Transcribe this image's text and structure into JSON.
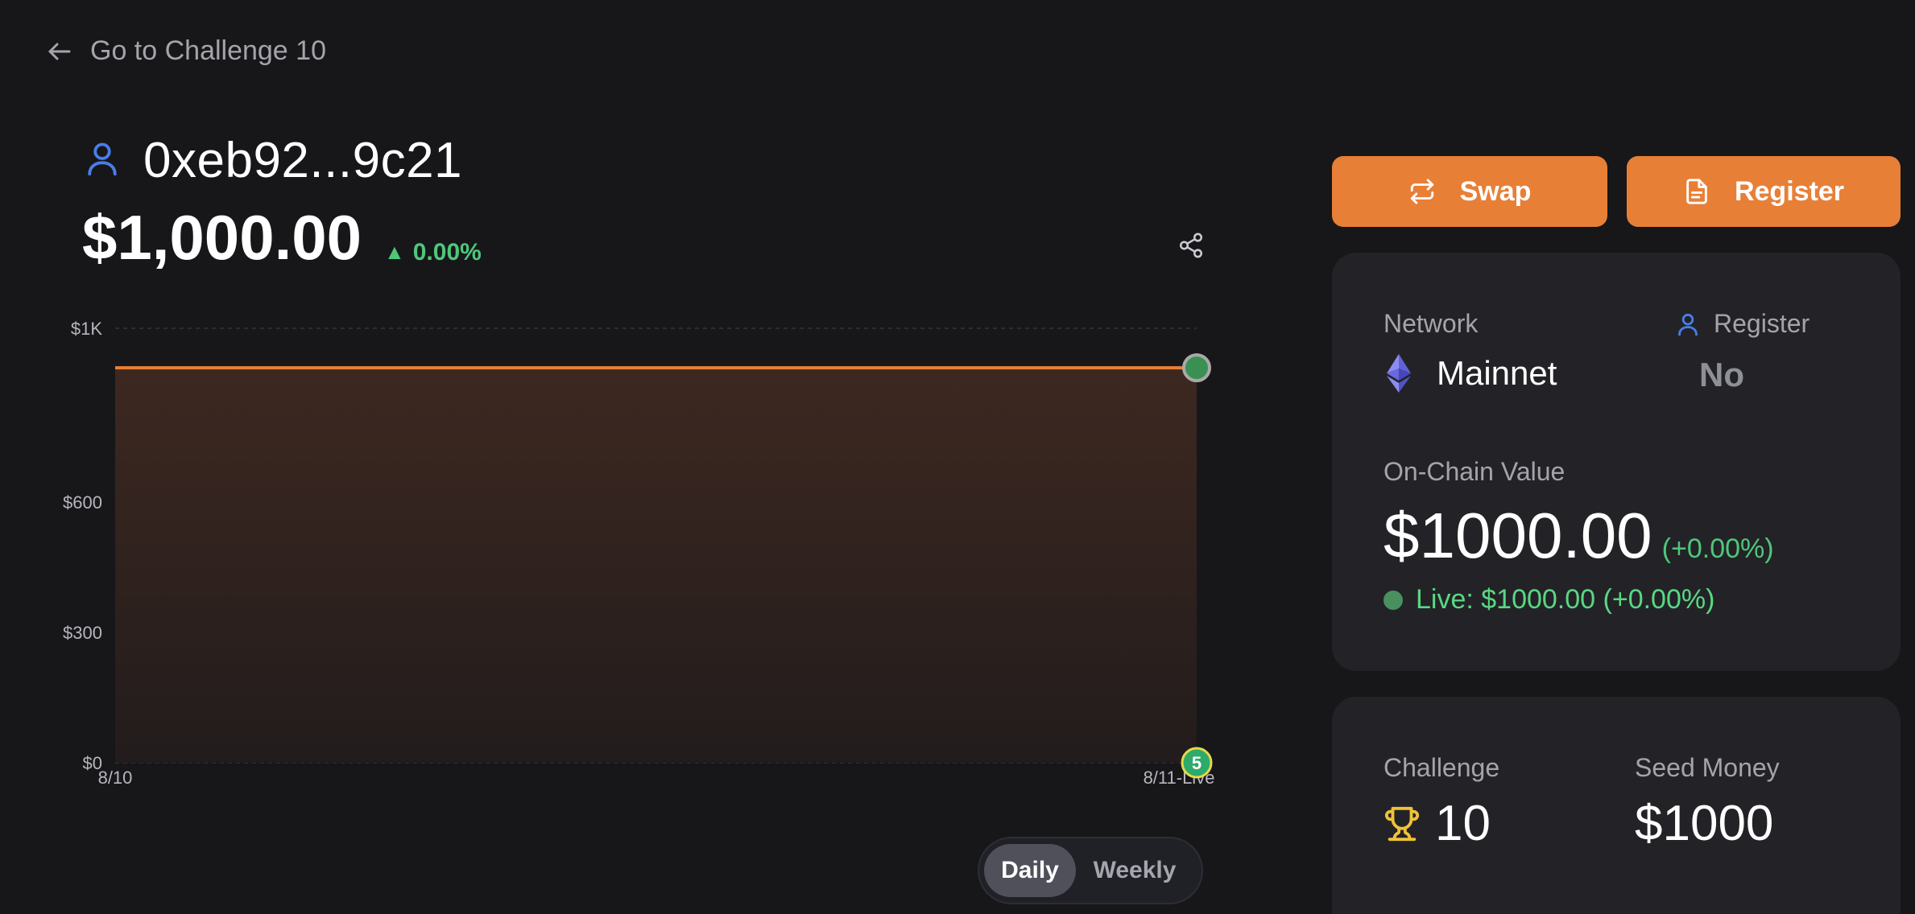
{
  "nav": {
    "back_label": "Go to Challenge 10"
  },
  "header": {
    "address": "0xeb92...9c21",
    "portfolio_value": "$1,000.00",
    "change_pct": "0.00%"
  },
  "chart_data": {
    "type": "area",
    "x": [
      "8/10",
      "8/11-Live"
    ],
    "series": [
      {
        "values": [
          909,
          909
        ]
      }
    ],
    "yticks": [
      {
        "label": "$1K",
        "value": 1000
      },
      {
        "label": "$600",
        "value": 600
      },
      {
        "label": "$300",
        "value": 300
      },
      {
        "label": "$0",
        "value": 0
      }
    ],
    "ylim": [
      0,
      1000
    ],
    "grid": true,
    "marker_badge": "5",
    "line_color": "#e87f37"
  },
  "range_toggle": {
    "options": [
      "Daily",
      "Weekly"
    ],
    "selected": "Daily"
  },
  "actions": {
    "swap_label": "Swap",
    "register_label": "Register"
  },
  "network_card": {
    "network_label": "Network",
    "network_value": "Mainnet",
    "register_label": "Register",
    "register_value": "No",
    "onchain_label": "On-Chain Value",
    "onchain_value": "$1000.00",
    "onchain_change": "(+0.00%)",
    "live_text": "Live: $1000.00 (+0.00%)"
  },
  "challenge_card": {
    "challenge_label": "Challenge",
    "challenge_value": "10",
    "seed_label": "Seed Money",
    "seed_value": "$1000"
  },
  "colors": {
    "accent": "#e87f37",
    "positive": "#4ec77a",
    "background": "#17171a",
    "card": "#232327",
    "icon_blue": "#4a7de8",
    "trophy": "#f0c23a"
  }
}
